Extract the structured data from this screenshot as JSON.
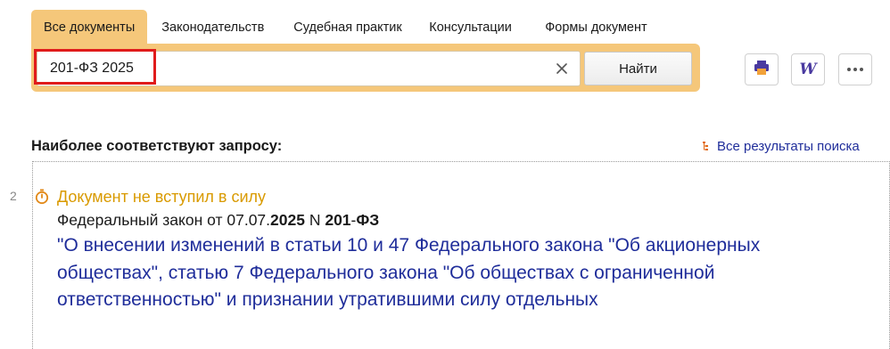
{
  "tabs": [
    {
      "label": "Все документы",
      "active": true
    },
    {
      "label": "Законодательств",
      "active": false
    },
    {
      "label": "Судебная практик",
      "active": false
    },
    {
      "label": "Консультации",
      "active": false
    },
    {
      "label": "Формы документ",
      "active": false
    }
  ],
  "search": {
    "value": "201-ФЗ 2025",
    "button_label": "Найти",
    "clear_icon": "close-icon"
  },
  "toolbar": {
    "print_icon": "print-icon",
    "word_label": "W",
    "more_icon": "more-icon"
  },
  "results": {
    "heading": "Наиболее соответствуют запросу:",
    "all_results_label": "Все результаты поиска",
    "items": [
      {
        "number": "2",
        "status": "Документ не вступил в силу",
        "doc_type_prefix": "Федеральный закон от 07.07.",
        "doc_year": "2025",
        "doc_n": " N ",
        "doc_number": "201",
        "doc_dash": "-",
        "doc_suffix": "ФЗ",
        "title": "\"О внесении изменений в статьи 10 и 47 Федерального закона \"Об акционерных обществах\", статью 7 Федерального закона \"Об обществах с ограниченной ответственностью\" и признании утратившими силу отдельных"
      }
    ]
  },
  "colors": {
    "accent": "#f5c77a",
    "link": "#1f2d9a",
    "status": "#d99a00",
    "highlight": "#e01b1b"
  }
}
